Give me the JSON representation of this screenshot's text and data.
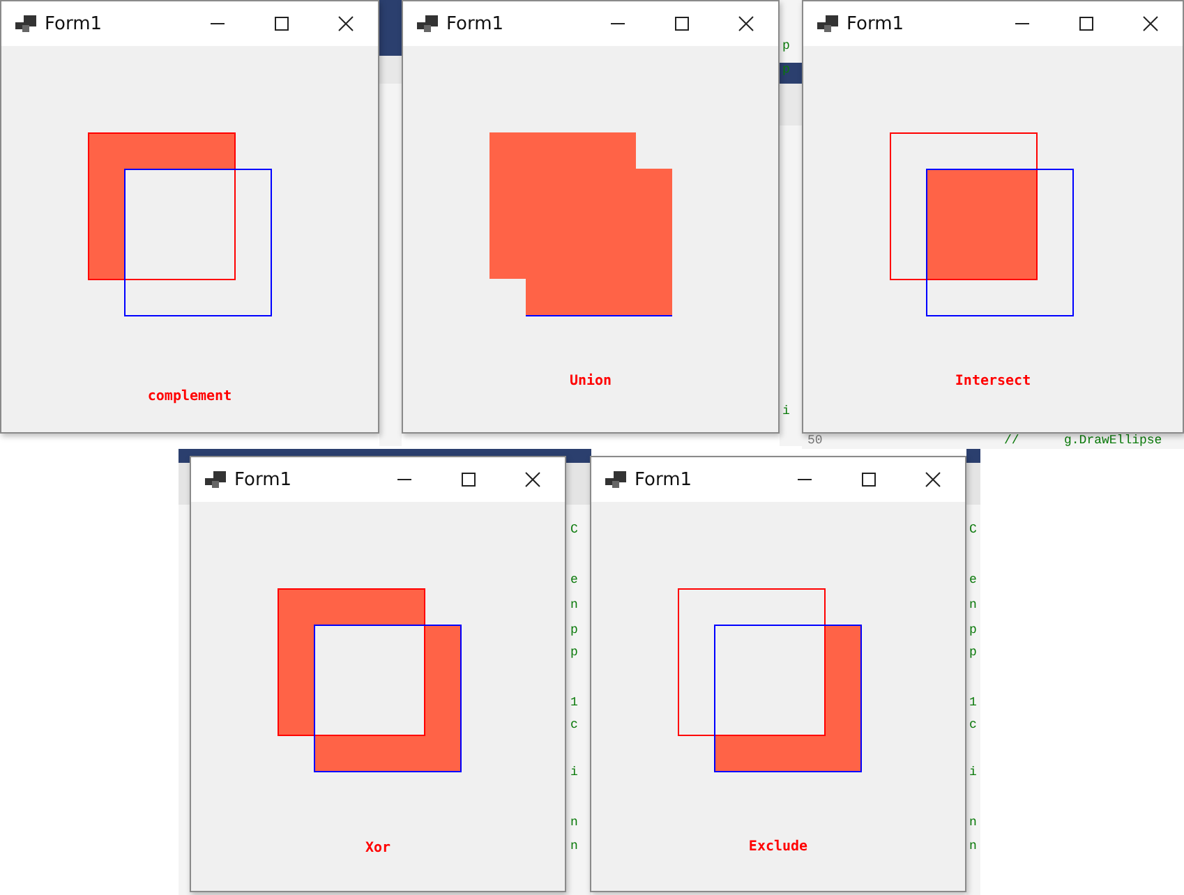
{
  "windows": [
    {
      "title": "Form1",
      "kind": "complement",
      "caption": "complement"
    },
    {
      "title": "Form1",
      "kind": "union",
      "caption": "Union"
    },
    {
      "title": "Form1",
      "kind": "intersect",
      "caption": "Intersect"
    },
    {
      "title": "Form1",
      "kind": "xor",
      "caption": "Xor"
    },
    {
      "title": "Form1",
      "kind": "exclude",
      "caption": "Exclude"
    }
  ],
  "editor_behind": {
    "gap_letters": [
      "p",
      "p",
      "i"
    ],
    "right_columns": [
      [
        "C",
        "e",
        "n",
        "p",
        "p",
        "1",
        "c",
        "i",
        "n",
        "n"
      ],
      [
        "C",
        "e",
        "n",
        "p",
        "p",
        "1",
        "c",
        "i",
        "n",
        "n"
      ]
    ],
    "bottom_line": {
      "line_number": "50",
      "comment": "//",
      "code": "g.DrawEllipse"
    }
  }
}
